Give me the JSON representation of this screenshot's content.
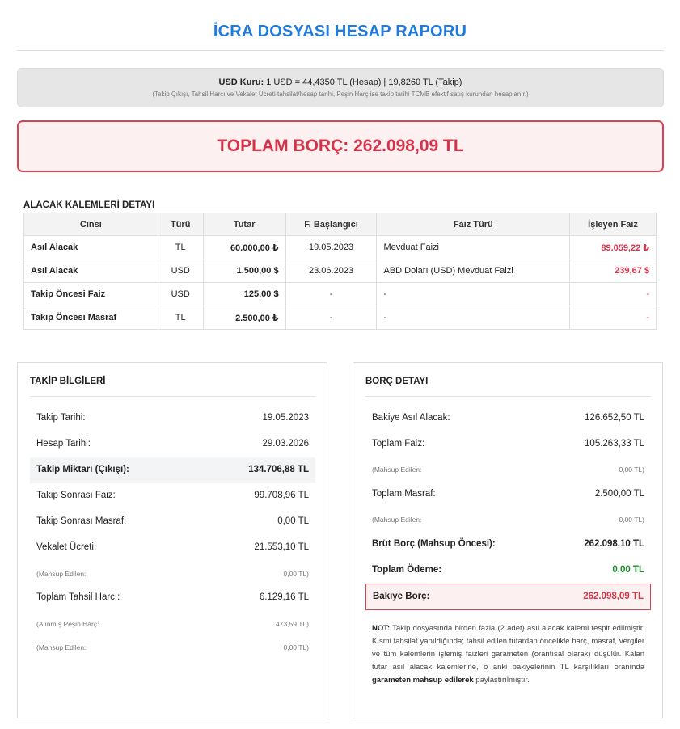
{
  "title": "İCRA DOSYASI HESAP RAPORU",
  "rate": {
    "label": "USD Kuru:",
    "text": " 1 USD = 44,4350 TL (Hesap)  |  19,8260 TL (Takip)",
    "note": "(Takip Çıkışı, Tahsil Harcı ve Vekalet Ücreti tahsilat/hesap tarihi, Peşin Harç ise takip tarihi TCMB efektif satış kurundan hesaplanır.)"
  },
  "total": "TOPLAM BORÇ: 262.098,09 TL",
  "items_section": {
    "title": "ALACAK KALEMLERİ DETAYI",
    "headers": [
      "Cinsi",
      "Türü",
      "Tutar",
      "F. Başlangıcı",
      "Faiz Türü",
      "İşleyen Faiz"
    ],
    "rows": [
      {
        "name": "Asıl Alacak",
        "type": "TL",
        "amount": "60.000,00 ₺",
        "start": "19.05.2023",
        "interest_type": "Mevduat Faizi",
        "interest": "89.059,22 ₺"
      },
      {
        "name": "Asıl Alacak",
        "type": "USD",
        "amount": "1.500,00 $",
        "start": "23.06.2023",
        "interest_type": "ABD Doları (USD) Mevduat Faizi",
        "interest": "239,67 $"
      },
      {
        "name": "Takip Öncesi Faiz",
        "type": "USD",
        "amount": "125,00 $",
        "start": "-",
        "interest_type": "-",
        "interest": "-"
      },
      {
        "name": "Takip Öncesi Masraf",
        "type": "TL",
        "amount": "2.500,00 ₺",
        "start": "-",
        "interest_type": "-",
        "interest": "-"
      }
    ]
  },
  "takip": {
    "title": "TAKİP BİLGİLERİ",
    "rows": [
      {
        "label": "Takip Tarihi:",
        "value": "19.05.2023"
      },
      {
        "label": "Hesap Tarihi:",
        "value": "29.03.2026"
      },
      {
        "label": "Takip Miktarı (Çıkışı):",
        "value": "134.706,88 TL"
      },
      {
        "label": "Takip Sonrası Faiz:",
        "value": "99.708,96 TL"
      },
      {
        "label": "Takip Sonrası Masraf:",
        "value": "0,00 TL"
      },
      {
        "label": "Vekalet Ücreti:",
        "value": "21.553,10 TL"
      },
      {
        "label": "(Mahsup Edilen:",
        "value": "0,00 TL)"
      },
      {
        "label": "Toplam Tahsil Harcı:",
        "value": "6.129,16 TL"
      },
      {
        "label": "(Alınmış Peşin Harç:",
        "value": "473,59 TL)"
      },
      {
        "label": "(Mahsup Edilen:",
        "value": "0,00 TL)"
      }
    ]
  },
  "borc": {
    "title": "BORÇ DETAYI",
    "rows": [
      {
        "label": "Bakiye Asıl Alacak:",
        "value": "126.652,50 TL"
      },
      {
        "label": "Toplam Faiz:",
        "value": "105.263,33 TL"
      },
      {
        "label": "(Mahsup Edilen:",
        "value": "0,00 TL)"
      },
      {
        "label": "Toplam Masraf:",
        "value": "2.500,00 TL"
      },
      {
        "label": "(Mahsup Edilen:",
        "value": "0,00 TL)"
      },
      {
        "label": "Brüt Borç (Mahsup Öncesi):",
        "value": "262.098,10 TL"
      },
      {
        "label": "Toplam Ödeme:",
        "value": "0,00 TL"
      },
      {
        "label": "Bakiye Borç:",
        "value": "262.098,09 TL"
      }
    ],
    "note_label": "NOT:",
    "note_text": " Takip dosyasında birden fazla (2 adet) asıl alacak kalemi tespit edilmiştir. Kısmi tahsilat yapıldığında; tahsil edilen tutardan öncelikle harç, masraf, vergiler ve tüm kalemlerin işlemiş faizleri garameten (orantısal olarak) düşülür. Kalan tutar asıl alacak kalemlerine, o anki bakiyelerinin TL karşılıkları oranında ",
    "note_bold": "garameten mahsup edilerek",
    "note_end": " paylaştırılmıştır."
  },
  "colors": {
    "accent": "#1f7ae0",
    "danger": "#d6334a",
    "success": "#1e8a2e"
  }
}
